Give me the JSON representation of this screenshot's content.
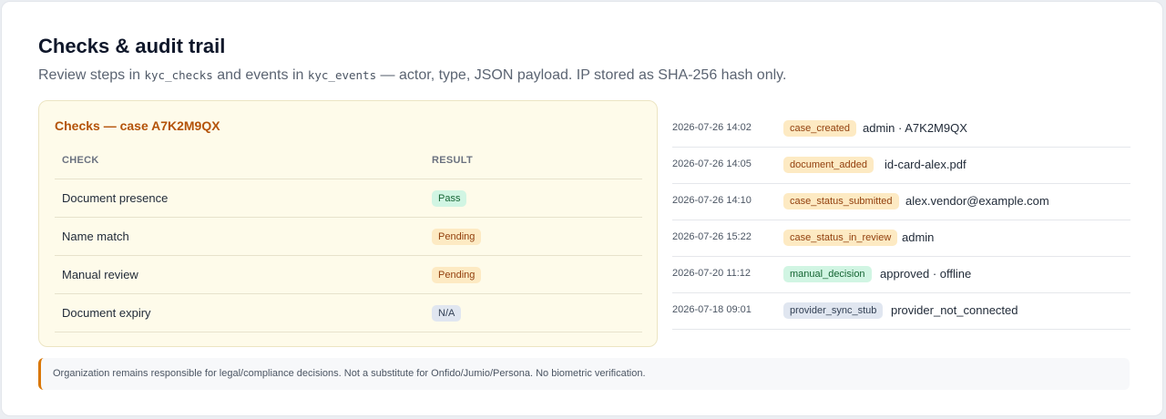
{
  "header": {
    "title": "Checks & audit trail",
    "subtitle_part1": "Review steps in ",
    "subtitle_code1": "kyc_checks",
    "subtitle_part2": " and events in ",
    "subtitle_code2": "kyc_events",
    "subtitle_part3": " — actor, type, JSON payload. IP stored as SHA-256 hash only."
  },
  "checks": {
    "title": "Checks — case A7K2M9QX",
    "columns": [
      "CHECK",
      "RESULT"
    ],
    "rows": [
      {
        "check": "Document presence",
        "result": "Pass",
        "status": "pass"
      },
      {
        "check": "Name match",
        "result": "Pending",
        "status": "pending"
      },
      {
        "check": "Manual review",
        "result": "Pending",
        "status": "pending"
      },
      {
        "check": "Document expiry",
        "result": "N/A",
        "status": "na"
      }
    ]
  },
  "events": [
    {
      "time": "2026-07-26 14:02",
      "type": "case_created",
      "detail": "admin · A7K2M9QX",
      "tone": "warm"
    },
    {
      "time": "2026-07-26 14:05",
      "type": "document_added",
      "detail": "id-card-alex.pdf",
      "tone": "warm"
    },
    {
      "time": "2026-07-26 14:10",
      "type": "case_status_submitted",
      "detail": "alex.vendor@example.com",
      "tone": "warm"
    },
    {
      "time": "2026-07-26 15:22",
      "type": "case_status_in_review",
      "detail": "admin",
      "tone": "warm"
    },
    {
      "time": "2026-07-20 11:12",
      "type": "manual_decision",
      "detail": "approved · offline",
      "tone": "green"
    },
    {
      "time": "2026-07-18 09:01",
      "type": "provider_sync_stub",
      "detail": "provider_not_connected",
      "tone": "gray"
    }
  ],
  "disclaimer": "Organization remains responsible for legal/compliance decisions. Not a substitute for Onfido/Jumio/Persona. No biometric verification.",
  "colors": {
    "accent": "#b45309",
    "pass": "#d1f5e3",
    "pending": "#fdeac3",
    "na": "#e0e6f0",
    "panel": "#fefbea"
  }
}
